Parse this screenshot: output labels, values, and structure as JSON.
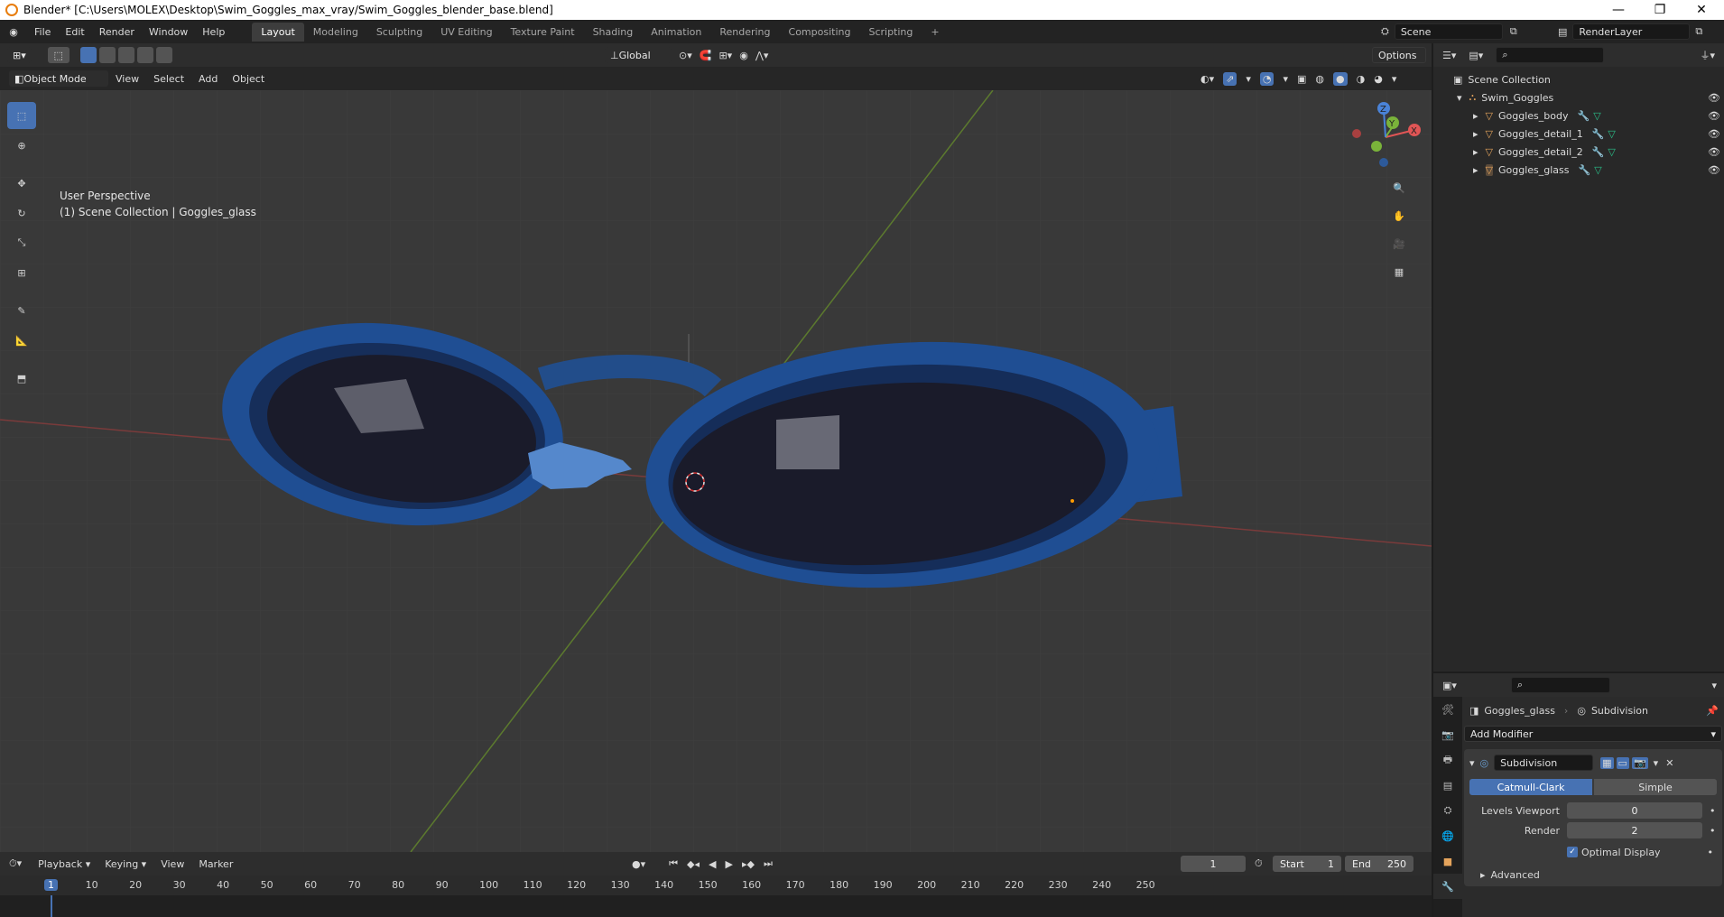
{
  "window": {
    "title": "Blender* [C:\\Users\\MOLEX\\Desktop\\Swim_Goggles_max_vray/Swim_Goggles_blender_base.blend]",
    "minimize": "—",
    "maximize": "❐",
    "close": "✕"
  },
  "menu": [
    "File",
    "Edit",
    "Render",
    "Window",
    "Help"
  ],
  "workspaces": [
    "Layout",
    "Modeling",
    "Sculpting",
    "UV Editing",
    "Texture Paint",
    "Shading",
    "Animation",
    "Rendering",
    "Compositing",
    "Scripting"
  ],
  "workspace_add": "+",
  "scene": {
    "name": "Scene",
    "renderlayer": "RenderLayer"
  },
  "viewport_header": {
    "transform_orientation": "Global",
    "options": "Options"
  },
  "viewport_header2": {
    "mode": "Object Mode",
    "items": [
      "View",
      "Select",
      "Add",
      "Object"
    ]
  },
  "overlay_text": {
    "line1": "User Perspective",
    "line2": "(1) Scene Collection | Goggles_glass"
  },
  "gizmo": {
    "x": "X",
    "y": "Y",
    "z": "Z"
  },
  "outliner": {
    "root": "Scene Collection",
    "collection": "Swim_Goggles",
    "objects": [
      "Goggles_body",
      "Goggles_detail_1",
      "Goggles_detail_2",
      "Goggles_glass"
    ]
  },
  "properties": {
    "object": "Goggles_glass",
    "modifier_crumb": "Subdivision",
    "add_modifier": "Add Modifier",
    "modifier_name": "Subdivision",
    "catmull": "Catmull-Clark",
    "simple": "Simple",
    "levels_viewport_label": "Levels Viewport",
    "levels_viewport": "0",
    "render_label": "Render",
    "render_levels": "2",
    "optimal_display": "Optimal Display",
    "advanced": "Advanced"
  },
  "timeline": {
    "playback": "Playback",
    "keying": "Keying",
    "view": "View",
    "marker": "Marker",
    "current_frame": "1",
    "start_label": "Start",
    "start": "1",
    "end_label": "End",
    "end": "250",
    "ruler": [
      "1",
      "10",
      "20",
      "30",
      "40",
      "50",
      "60",
      "70",
      "80",
      "90",
      "100",
      "110",
      "120",
      "130",
      "140",
      "150",
      "160",
      "170",
      "180",
      "190",
      "200",
      "210",
      "220",
      "230",
      "240",
      "250"
    ]
  },
  "colors": {
    "accent": "#4772b3",
    "goggle_blue": "#1f4e93",
    "lens": "#1a1b2a"
  }
}
